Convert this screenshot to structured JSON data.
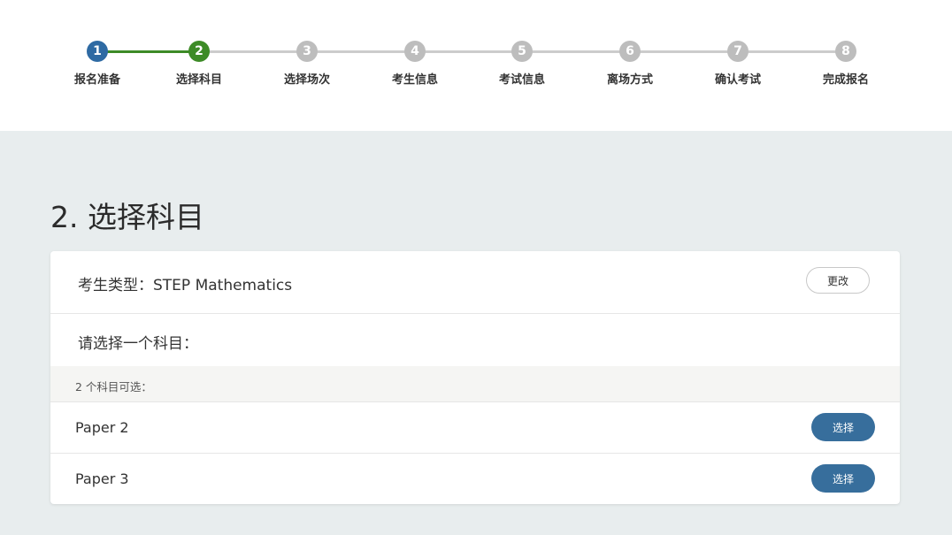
{
  "stepper": {
    "steps": [
      {
        "number": "1",
        "label": "报名准备",
        "state": "done"
      },
      {
        "number": "2",
        "label": "选择科目",
        "state": "current"
      },
      {
        "number": "3",
        "label": "选择场次",
        "state": "todo"
      },
      {
        "number": "4",
        "label": "考生信息",
        "state": "todo"
      },
      {
        "number": "5",
        "label": "考试信息",
        "state": "todo"
      },
      {
        "number": "6",
        "label": "离场方式",
        "state": "todo"
      },
      {
        "number": "7",
        "label": "确认考试",
        "state": "todo"
      },
      {
        "number": "8",
        "label": "完成报名",
        "state": "todo"
      }
    ]
  },
  "page": {
    "title": "2. 选择科目"
  },
  "card": {
    "candidate_type": "考生类型：STEP Mathematics",
    "change_label": "更改",
    "prompt": "请选择一个科目：",
    "available_count": "2 个科目可选：",
    "subjects": [
      {
        "name": "Paper 2",
        "select_label": "选择"
      },
      {
        "name": "Paper 3",
        "select_label": "选择"
      }
    ]
  },
  "colors": {
    "done": "#2e6aa3",
    "current": "#3d8b27",
    "todo": "#bdbdbd",
    "line_done": "#3d8b27",
    "line_todo": "#cccccc",
    "select_button": "#376e9c"
  }
}
